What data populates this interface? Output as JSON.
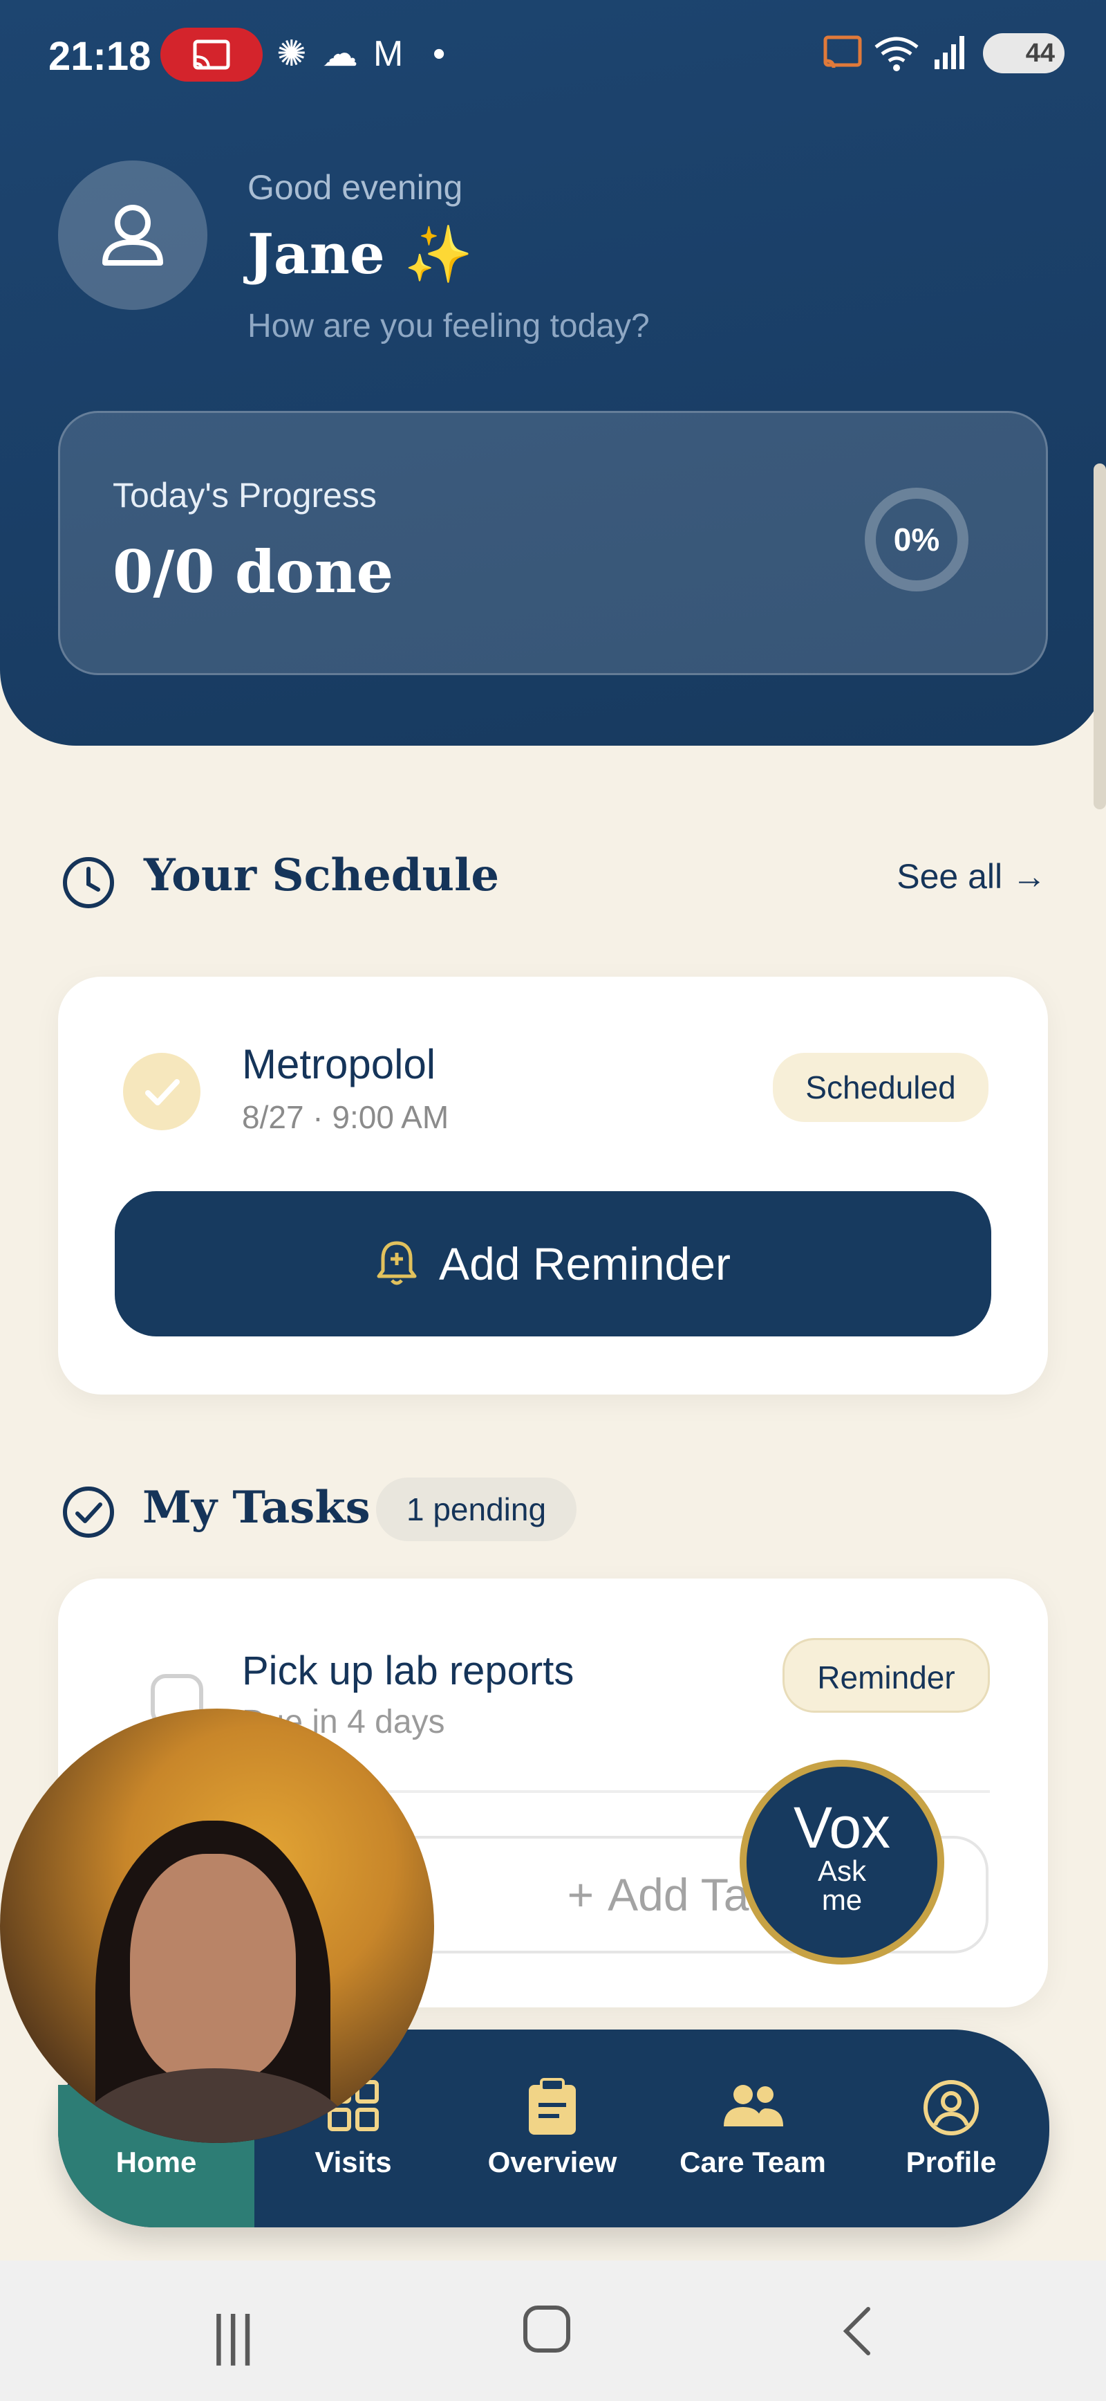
{
  "status_bar": {
    "time": "21:18",
    "battery": "44"
  },
  "header": {
    "greeting": "Good evening",
    "name": "Jane ✨",
    "subtitle": "How are you feeling today?"
  },
  "progress": {
    "label": "Today's Progress",
    "value": "0/0 done",
    "percent": "0%",
    "fraction": 0
  },
  "schedule": {
    "title": "Your Schedule",
    "see_all": "See all →",
    "item": {
      "name": "Metropolol",
      "datetime": "8/27 · 9:00 AM",
      "status": "Scheduled"
    },
    "add_reminder": "Add Reminder"
  },
  "tasks": {
    "title": "My Tasks",
    "pending": "1 pending",
    "item": {
      "name": "Pick up lab reports",
      "due": "Due in 4 days",
      "tag": "Reminder"
    },
    "add_task": "Add Task"
  },
  "vox": {
    "title": "Vox",
    "subtitle_line1": "Ask",
    "subtitle_line2": "me"
  },
  "nav": [
    {
      "label": "Home",
      "icon": "home-icon"
    },
    {
      "label": "Visits",
      "icon": "grid-icon"
    },
    {
      "label": "Overview",
      "icon": "clipboard-icon"
    },
    {
      "label": "Care Team",
      "icon": "people-icon"
    },
    {
      "label": "Profile",
      "icon": "profile-circle-icon"
    }
  ],
  "colors": {
    "primary": "#173a5f",
    "accent_gold": "#c7a245",
    "home_active": "#2d7d75",
    "background": "#f6f1e6"
  }
}
